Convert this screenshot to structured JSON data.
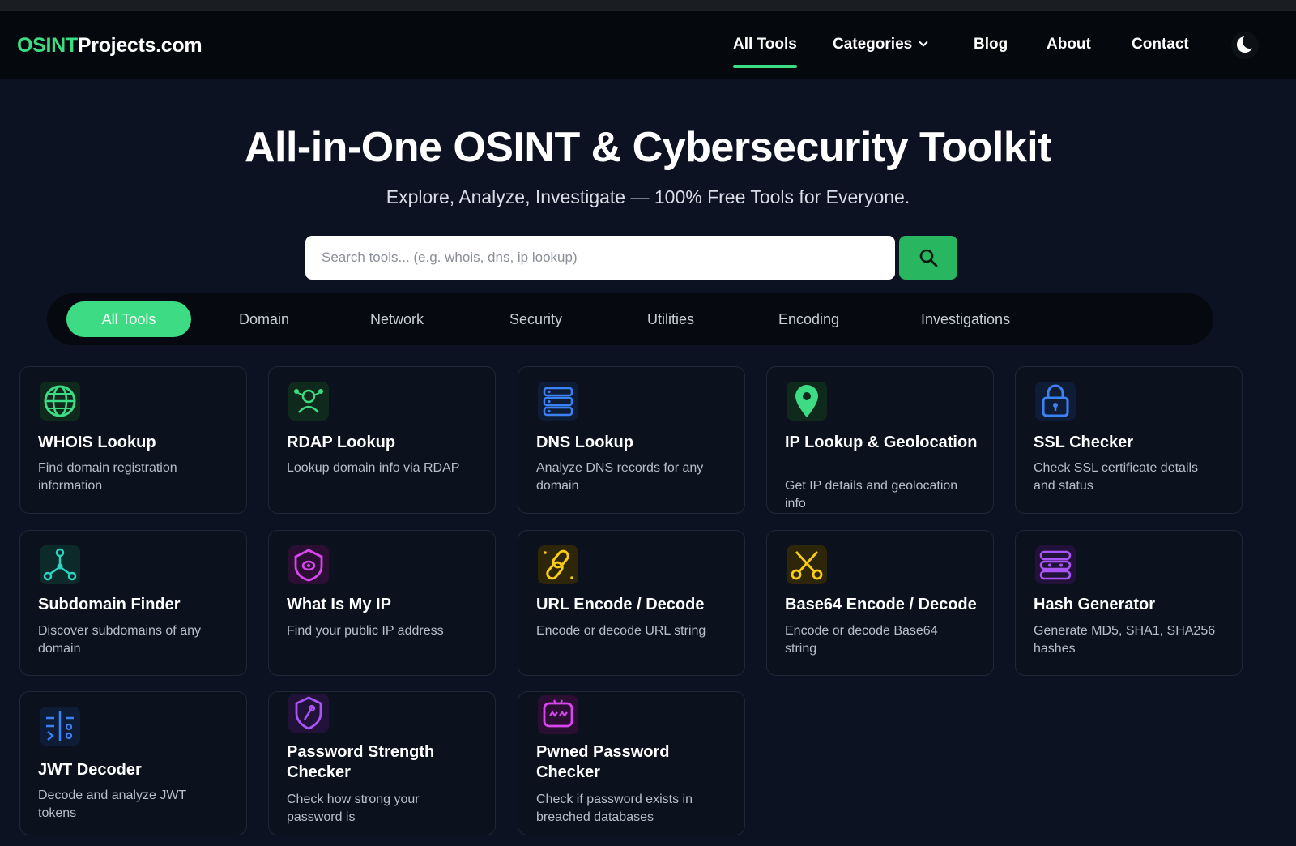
{
  "header": {
    "logo_highlight": "OSINT",
    "logo_rest": "Projects.com",
    "nav": [
      {
        "label": "All Tools",
        "active": true
      },
      {
        "label": "Categories",
        "dropdown": true
      },
      {
        "label": "Blog"
      },
      {
        "label": "About"
      },
      {
        "label": "Contact"
      }
    ],
    "theme_toggle_icon": "moon-icon"
  },
  "hero": {
    "title": "All-in-One OSINT & Cybersecurity Toolkit",
    "subtitle": "Explore, Analyze, Investigate — 100% Free Tools for Everyone."
  },
  "search": {
    "placeholder": "Search tools... (e.g. whois, dns, ip lookup)",
    "value": "",
    "button_icon": "search-icon"
  },
  "filters": [
    {
      "label": "All Tools",
      "active": true
    },
    {
      "label": "Domain"
    },
    {
      "label": "Network"
    },
    {
      "label": "Security"
    },
    {
      "label": "Utilities"
    },
    {
      "label": "Encoding"
    },
    {
      "label": "Investigations"
    }
  ],
  "tools": [
    {
      "title": "WHOIS Lookup",
      "desc": "Find domain registration information",
      "icon": "globe-icon",
      "color": "#3ddc84"
    },
    {
      "title": "RDAP Lookup",
      "desc": "Lookup domain info via RDAP",
      "icon": "network-user-icon",
      "color": "#3ddc84"
    },
    {
      "title": "DNS Lookup",
      "desc": "Analyze DNS records for any domain",
      "icon": "dns-server-icon",
      "color": "#3b82f6"
    },
    {
      "title": "IP Lookup & Geolocation",
      "desc": "Get IP details and geolocation info",
      "icon": "map-pin-icon",
      "color": "#3ddc84"
    },
    {
      "title": "SSL Checker",
      "desc": "Check SSL certificate details and status",
      "icon": "lock-icon",
      "color": "#3b82f6"
    },
    {
      "title": "Subdomain Finder",
      "desc": "Discover subdomains of any domain",
      "icon": "graph-nodes-icon",
      "color": "#2dd4bf"
    },
    {
      "title": "What Is My IP",
      "desc": "Find your public IP address",
      "icon": "ip-shield-icon",
      "color": "#c026d3"
    },
    {
      "title": "URL Encode / Decode",
      "desc": "Encode or decode URL string",
      "icon": "link-icon",
      "color": "#facc15"
    },
    {
      "title": "Base64 Encode / Decode",
      "desc": "Encode or decode Base64 string",
      "icon": "scissors-icon",
      "color": "#facc15"
    },
    {
      "title": "Hash Generator",
      "desc": "Generate MD5, SHA1, SHA256 hashes",
      "icon": "hash-grid-icon",
      "color": "#a855f7"
    },
    {
      "title": "JWT Decoder",
      "desc": "Decode and analyze JWT tokens",
      "icon": "token-icon",
      "color": "#3b82f6"
    },
    {
      "title": "Password Strength Checker",
      "desc": "Check how strong your password is",
      "icon": "key-shield-icon",
      "color": "#a855f7"
    },
    {
      "title": "Pwned Password Checker",
      "desc": "Check if password exists in breached databases",
      "icon": "breach-icon",
      "color": "#c026d3"
    }
  ]
}
